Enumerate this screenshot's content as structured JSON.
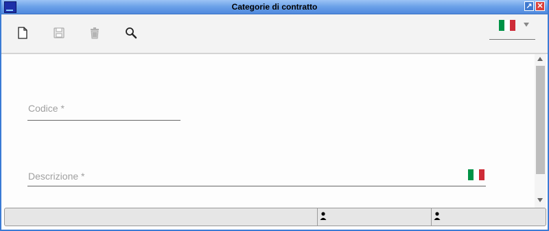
{
  "window": {
    "title": "Categorie di contratto",
    "icons": {
      "app": "app-icon",
      "restore": "restore-icon",
      "close": "close-icon"
    },
    "restore_glyph": "↗",
    "close_glyph": "✕"
  },
  "toolbar": {
    "tools": [
      {
        "name": "new-document-icon",
        "enabled": true
      },
      {
        "name": "save-icon",
        "enabled": false
      },
      {
        "name": "delete-icon",
        "enabled": false
      },
      {
        "name": "search-icon",
        "enabled": true
      }
    ],
    "language": {
      "selected": "it",
      "icon": "italian-flag-icon",
      "colors": [
        "#009246",
        "#ffffff",
        "#ce2b37"
      ]
    }
  },
  "form": {
    "codice": {
      "label": "Codice *",
      "value": ""
    },
    "descrizione": {
      "label": "Descrizione *",
      "value": "",
      "language_icon": "italian-flag-icon"
    }
  },
  "statusbar": {
    "cells": [
      {
        "text": ""
      },
      {
        "icon": "user-icon",
        "text": ""
      },
      {
        "icon": "user-icon",
        "text": ""
      }
    ]
  }
}
